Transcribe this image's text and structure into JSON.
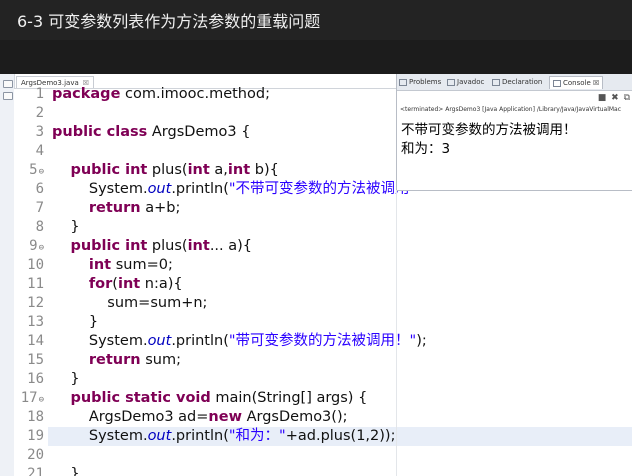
{
  "video_title": "6-3 可变参数列表作为方法参数的重载问题",
  "editor": {
    "tab_label": "ArgsDemo3.java",
    "tab_close": "☒",
    "lines": [
      {
        "n": "1",
        "fold": "",
        "html": "<span class=\"kw\">package</span> com.imooc.method;"
      },
      {
        "n": "2",
        "fold": "",
        "html": ""
      },
      {
        "n": "3",
        "fold": "",
        "html": "<span class=\"kw\">public class</span> ArgsDemo3 {"
      },
      {
        "n": "4",
        "fold": "",
        "html": ""
      },
      {
        "n": "5",
        "fold": "⊖",
        "html": "    <span class=\"kw\">public int</span> plus(<span class=\"kw\">int</span> a,<span class=\"kw\">int</span> b){"
      },
      {
        "n": "6",
        "fold": "",
        "html": "        System.<span class=\"it\">out</span>.println(<span class=\"st\">\"不带可变参数的方法被调用</span>"
      },
      {
        "n": "7",
        "fold": "",
        "html": "        <span class=\"kw\">return</span> a+b;"
      },
      {
        "n": "8",
        "fold": "",
        "html": "    }"
      },
      {
        "n": "9",
        "fold": "⊖",
        "html": "    <span class=\"kw\">public int</span> plus(<span class=\"kw\">int</span>... a){"
      },
      {
        "n": "10",
        "fold": "",
        "html": "        <span class=\"kw\">int</span> sum=0;"
      },
      {
        "n": "11",
        "fold": "",
        "html": "        <span class=\"kw\">for</span>(<span class=\"kw\">int</span> n:a){"
      },
      {
        "n": "12",
        "fold": "",
        "html": "            sum=sum+n;"
      },
      {
        "n": "13",
        "fold": "",
        "html": "        }"
      },
      {
        "n": "14",
        "fold": "",
        "html": "        System.<span class=\"it\">out</span>.println(<span class=\"st\">\"带可变参数的方法被调用！\"</span>);"
      },
      {
        "n": "15",
        "fold": "",
        "html": "        <span class=\"kw\">return</span> sum;"
      },
      {
        "n": "16",
        "fold": "",
        "html": "    }"
      },
      {
        "n": "17",
        "fold": "⊖",
        "html": "    <span class=\"kw\">public static void</span> main(String[] args) {"
      },
      {
        "n": "18",
        "fold": "",
        "html": "        ArgsDemo3 ad=<span class=\"kw\">new</span> ArgsDemo3();"
      },
      {
        "n": "19",
        "fold": "",
        "html": "        System.<span class=\"it\">out</span>.println(<span class=\"st\">\"和为：\"</span>+ad.plus(1,2));"
      },
      {
        "n": "20",
        "fold": "",
        "html": ""
      },
      {
        "n": "21",
        "fold": "",
        "html": "    }"
      }
    ]
  },
  "console": {
    "tabs": [
      "Problems",
      "Javadoc",
      "Declaration",
      "Console"
    ],
    "active_tab_close": "☒",
    "tool_glyphs": "■ ✖ ⧉",
    "terminated": "<terminated> ArgsDemo3 [Java Application] /Library/Java/JavaVirtualMac",
    "output": [
      "不带可变参数的方法被调用！",
      "和为：3"
    ]
  },
  "colors": {
    "keyword": "#7f0055",
    "string": "#2a00ff",
    "field": "#0000c0",
    "current_line": "#e8eef8"
  }
}
